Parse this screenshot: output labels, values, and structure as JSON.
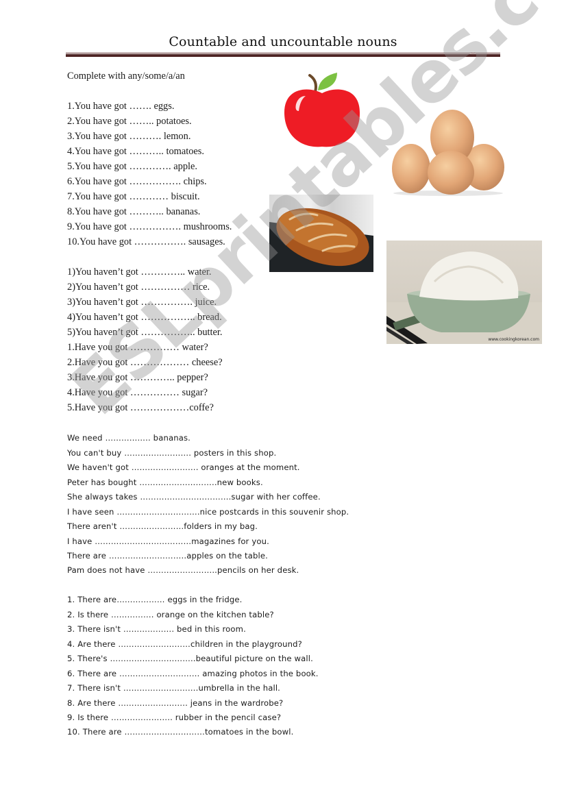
{
  "document": {
    "title": "Countable and uncountable nouns",
    "instruction": "Complete with any/some/a/an",
    "watermark": "ESLprintables.com",
    "colors": {
      "title_rule": "#4e2424",
      "apple_red": "#ee1c25",
      "leaf_green": "#7cc142"
    }
  },
  "section_have_got": [
    "1.You have got ……. eggs.",
    "2.You have got …….. potatoes.",
    "3.You have got ………. lemon.",
    "4.You have got ……….. tomatoes.",
    "5.You have got …………. apple.",
    "6.You have got ……………. chips.",
    "7.You have got ………… biscuit.",
    "8.You have got ……….. bananas.",
    "9.You have got ……………. mushrooms.",
    "10.You have got ……………. sausages."
  ],
  "section_havent_got": [
    "1)You haven’t got ………….. water.",
    "2)You haven’t got …………… rice.",
    "3)You haven’t got ……………. juice.",
    "4)You haven’t got …………….. bread.",
    "5)You haven’t got …………….. butter."
  ],
  "section_have_you_got": [
    "1.Have you got …………… water?",
    "2.Have you got ……………… cheese?",
    "3.Have you got ………….. pepper?",
    "4.Have you got …………… sugar?",
    "5.Have you got ………………coffe?"
  ],
  "section_sentences": [
    "We need    ……………..    bananas.",
    "You can't buy ……………………. posters in this shop.",
    "We haven't got ……………………. oranges at the moment.",
    "Peter has bought ………………………..new books.",
    "She always takes …………………………….sugar with her coffee.",
    "I have seen ………………………….nice postcards in this souvenir shop.",
    "There aren't   ……………………folders in my bag.",
    "I have ………………………………magazines for you.",
    "There are ………………………..apples on the table.",
    "Pam does not have ……………………..pencils on her desk."
  ],
  "section_there": [
    "1. There are……………… eggs in the fridge.",
    "2. Is there ……………. orange on the kitchen table?",
    "3. There isn't ………………. bed in this room.",
    "4. Are there ………………………children in the playground?",
    "5. There's …………………………..beautiful picture on the wall.",
    "6. There are ………………………… amazing photos in the book.",
    "7. There isn't ……………………….umbrella in the hall.",
    "8. Are there …………………….. jeans in the wardrobe?",
    "9. Is there ………………….. rubber in the pencil case?",
    "10. There are …………………………tomatoes in the bowl."
  ],
  "images": {
    "apple": "apple-image",
    "eggs": "eggs-image",
    "bread": "bread-image",
    "rice": "rice-bowl-image",
    "rice_credit": "www.cookingkorean.com"
  }
}
